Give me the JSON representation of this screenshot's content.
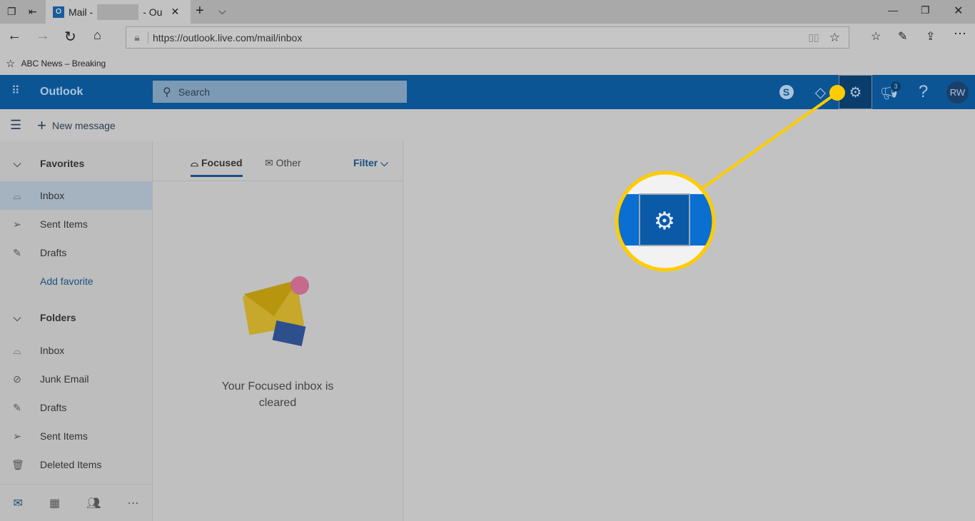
{
  "browser": {
    "tab_title_prefix": "Mail -",
    "tab_title_suffix": "- Ou",
    "url": "https://outlook.live.com/mail/inbox",
    "favorite": "ABC News – Breaking"
  },
  "header": {
    "app_name": "Outlook",
    "search_placeholder": "Search",
    "notification_count": "3",
    "avatar_initials": "RW",
    "brand_color": "#0c5595"
  },
  "command": {
    "new_message": "New message"
  },
  "sidebar": {
    "favorites_label": "Favorites",
    "favorites": [
      {
        "label": "Inbox",
        "icon": "inbox-icon",
        "selected": true
      },
      {
        "label": "Sent Items",
        "icon": "send-icon"
      },
      {
        "label": "Drafts",
        "icon": "pencil-icon"
      }
    ],
    "add_favorite": "Add favorite",
    "folders_label": "Folders",
    "folders": [
      {
        "label": "Inbox",
        "icon": "inbox-icon"
      },
      {
        "label": "Junk Email",
        "icon": "block-icon"
      },
      {
        "label": "Drafts",
        "icon": "pencil-icon"
      },
      {
        "label": "Sent Items",
        "icon": "send-icon"
      },
      {
        "label": "Deleted Items",
        "icon": "trash-icon"
      }
    ]
  },
  "list": {
    "tab_focused": "Focused",
    "tab_other": "Other",
    "filter": "Filter",
    "empty_line1": "Your Focused inbox is",
    "empty_line2": "cleared"
  },
  "annotation": {
    "color": "#ffcc00",
    "target": "settings-gear"
  }
}
